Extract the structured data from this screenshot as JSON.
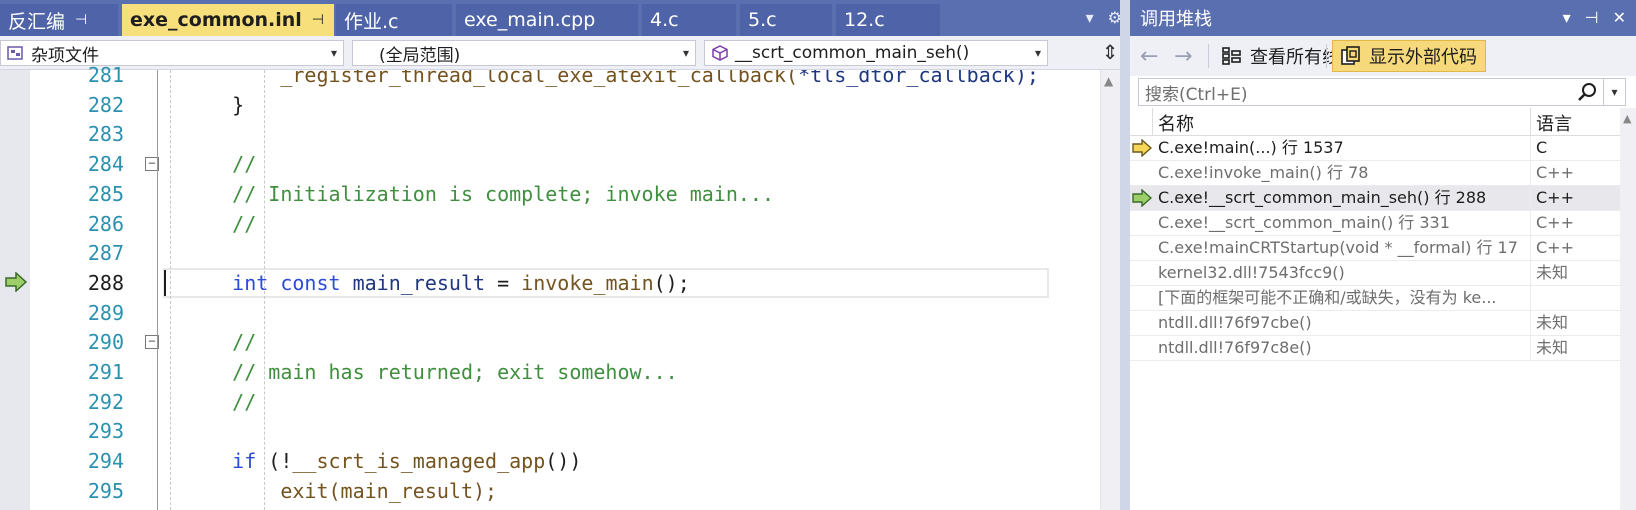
{
  "editor": {
    "tabs": [
      {
        "label": "反汇编",
        "pin": "⊣"
      },
      {
        "label": "exe_common.inl",
        "pin": "⊣",
        "close": "✕",
        "active": true
      },
      {
        "label": "作业.c"
      },
      {
        "label": "exe_main.cpp"
      },
      {
        "label": "4.c"
      },
      {
        "label": "5.c"
      },
      {
        "label": "12.c"
      }
    ],
    "tabbar_tools": {
      "dropdown": "▾",
      "settings": "⚙"
    },
    "nav": {
      "project": "杂项文件",
      "scope": "(全局范围)",
      "member": "__scrt_common_main_seh()",
      "arrow": "▾",
      "split": "⇕"
    },
    "lines": [
      {
        "num": "281",
        "parts": [
          {
            "t": "        _register_thread_local_exe_atexit_callback(",
            "c": "fn"
          },
          {
            "t": "*tls_dtor_callback);",
            "c": "id"
          }
        ]
      },
      {
        "num": "282",
        "parts": [
          {
            "t": "    }",
            "c": "txt"
          }
        ]
      },
      {
        "num": "283",
        "parts": []
      },
      {
        "num": "284",
        "parts": [
          {
            "t": "    //",
            "c": "cmt"
          }
        ],
        "fold": "−"
      },
      {
        "num": "285",
        "parts": [
          {
            "t": "    // Initialization is complete; invoke main...",
            "c": "cmt"
          }
        ]
      },
      {
        "num": "286",
        "parts": [
          {
            "t": "    //",
            "c": "cmt"
          }
        ]
      },
      {
        "num": "287",
        "parts": []
      },
      {
        "num": "288",
        "parts": [
          {
            "t": "    int const",
            "c": "kw"
          },
          {
            "t": " main_result",
            "c": "id"
          },
          {
            "t": " = ",
            "c": "txt"
          },
          {
            "t": "invoke_main",
            "c": "fn"
          },
          {
            "t": "();",
            "c": "txt"
          }
        ],
        "current": true
      },
      {
        "num": "289",
        "parts": []
      },
      {
        "num": "290",
        "parts": [
          {
            "t": "    //",
            "c": "cmt"
          }
        ],
        "fold": "−"
      },
      {
        "num": "291",
        "parts": [
          {
            "t": "    // main has returned; exit somehow...",
            "c": "cmt"
          }
        ]
      },
      {
        "num": "292",
        "parts": [
          {
            "t": "    //",
            "c": "cmt"
          }
        ]
      },
      {
        "num": "293",
        "parts": []
      },
      {
        "num": "294",
        "parts": [
          {
            "t": "    if",
            "c": "kw"
          },
          {
            "t": " (!",
            "c": "txt"
          },
          {
            "t": "__scrt_is_managed_app",
            "c": "fn"
          },
          {
            "t": "())",
            "c": "txt"
          }
        ]
      },
      {
        "num": "295",
        "parts": [
          {
            "t": "        exit(main_result);",
            "c": "fn"
          }
        ]
      }
    ],
    "scroll_up": "▲"
  },
  "callstack": {
    "title": "调用堆栈",
    "title_tools": {
      "dropdown": "▾",
      "pin": "⊣",
      "close": "✕"
    },
    "nav_back": "←",
    "nav_forward": "→",
    "view_threads": "查看所有线程",
    "show_external": "显示外部代码",
    "search_placeholder": "搜索(Ctrl+E)",
    "search_drop": "▾",
    "col_name": "名称",
    "col_lang": "语言",
    "rows": [
      {
        "name": "C.exe!main(...) 行 1537",
        "lang": "C",
        "icon": "yellow-arrow",
        "tone": "dark"
      },
      {
        "name": "C.exe!invoke_main() 行 78",
        "lang": "C++",
        "tone": "grey"
      },
      {
        "name": "C.exe!__scrt_common_main_seh() 行 288",
        "lang": "C++",
        "icon": "green-arrow",
        "tone": "dark",
        "current": true
      },
      {
        "name": "C.exe!__scrt_common_main() 行 331",
        "lang": "C++",
        "tone": "grey"
      },
      {
        "name": "C.exe!mainCRTStartup(void * __formal) 行 17",
        "lang": "C++",
        "tone": "grey"
      },
      {
        "name": "kernel32.dll!7543fcc9()",
        "lang": "未知",
        "tone": "grey"
      },
      {
        "name": "[下面的框架可能不正确和/或缺失，没有为 ke...",
        "lang": "",
        "tone": "grey"
      },
      {
        "name": "ntdll.dll!76f97cbe()",
        "lang": "未知",
        "tone": "grey"
      },
      {
        "name": "ntdll.dll!76f97c8e()",
        "lang": "未知",
        "tone": "grey"
      }
    ],
    "scroll_up": "▲"
  },
  "colors": {
    "title_bar": "#5a6fb0",
    "active_tab": "#f7df7b",
    "comment": "#3f8f3f",
    "keyword": "#2b4cd6",
    "function": "#74531f",
    "identifier": "#1f377f",
    "line_number": "#2b91af"
  }
}
